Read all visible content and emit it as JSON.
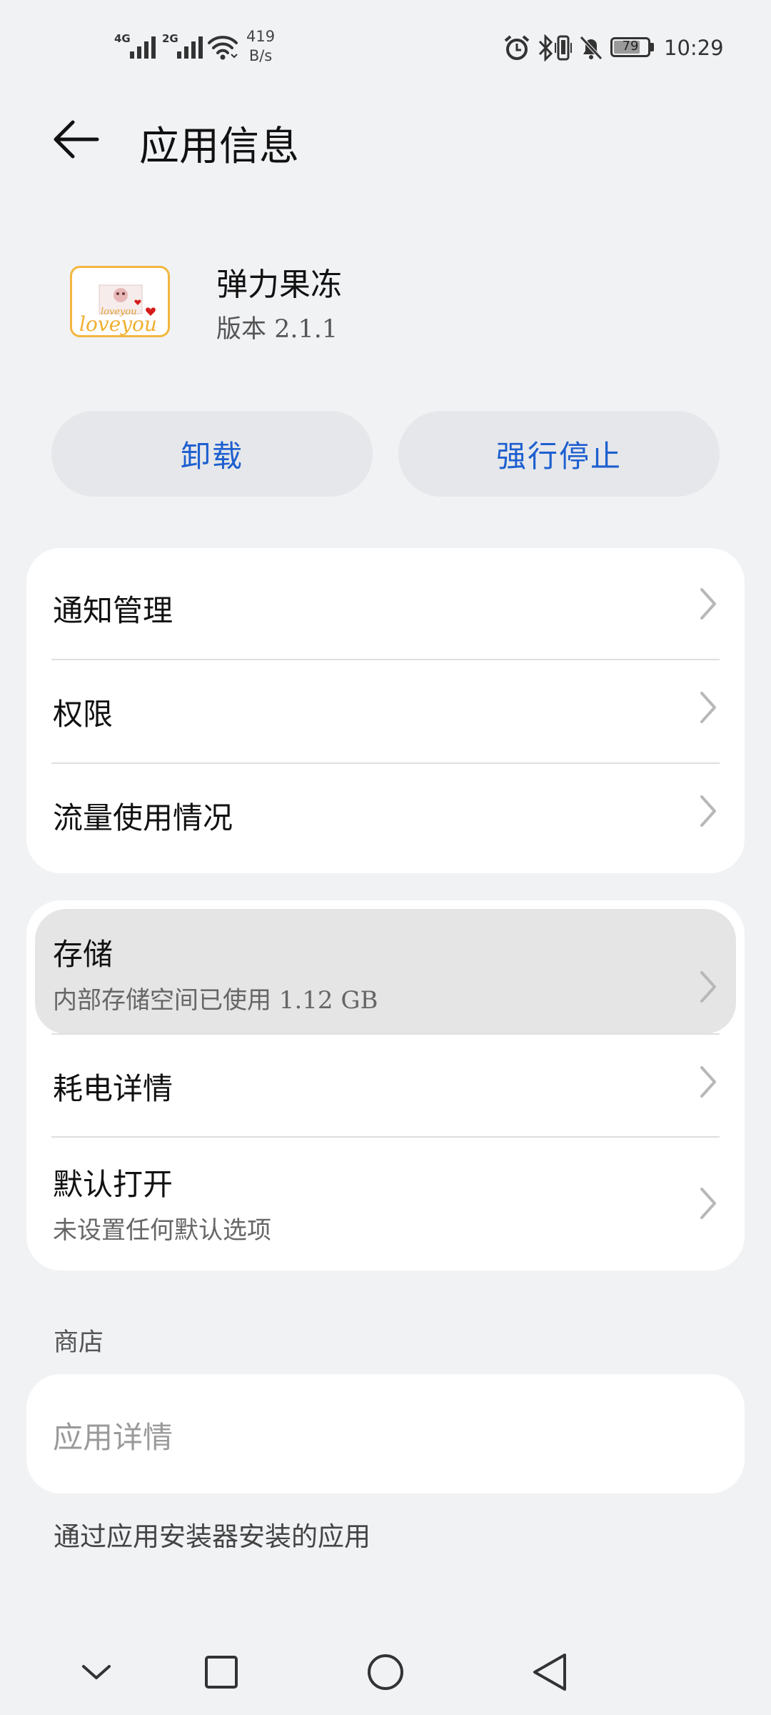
{
  "status_bar": {
    "net1": "4G",
    "net2": "2G",
    "speed_value": "419",
    "speed_unit": "B/s",
    "battery": "79",
    "battery_level_pct": 79,
    "time": "10:29",
    "icons": [
      "signal-icon",
      "signal-icon",
      "wifi-icon",
      "alarm-icon",
      "bluetooth-icon",
      "vibrate-icon",
      "mute-bell-icon",
      "battery-icon"
    ]
  },
  "header": {
    "title": "应用信息",
    "back_icon": "arrow-left-icon"
  },
  "app": {
    "name": "弹力果冻",
    "version": "版本 2.1.1",
    "icon_text": "loveyou",
    "icon_text_small": "loveyou"
  },
  "actions": {
    "uninstall": "卸载",
    "force_stop": "强行停止",
    "accent_color": "#1d5fd0"
  },
  "group1": {
    "items": [
      {
        "label": "通知管理"
      },
      {
        "label": "权限"
      },
      {
        "label": "流量使用情况"
      }
    ]
  },
  "group2": {
    "items": [
      {
        "label": "存储",
        "sub": "内部存储空间已使用 1.12 GB"
      },
      {
        "label": "耗电详情"
      },
      {
        "label": "默认打开",
        "sub": "未设置任何默认选项"
      }
    ]
  },
  "store": {
    "section": "商店",
    "details": "应用详情"
  },
  "installer_note": "通过应用安装器安装的应用",
  "nav": {
    "icons": [
      "chevron-down-icon",
      "square-icon",
      "circle-icon",
      "triangle-back-icon"
    ]
  }
}
